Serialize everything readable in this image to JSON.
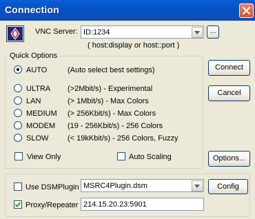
{
  "window": {
    "title": "Connection"
  },
  "server": {
    "label": "VNC Server:",
    "value": "ID:1234",
    "browse_label": "...",
    "hint": "( host:display or host::port )"
  },
  "quick_options": {
    "title": "Quick Options",
    "selected": "AUTO",
    "options": [
      {
        "name": "AUTO",
        "desc": "(Auto select best settings)"
      },
      {
        "name": "ULTRA",
        "desc": "(>2Mbit/s) - Experimental"
      },
      {
        "name": "LAN",
        "desc": "(> 1Mbit/s) - Max Colors"
      },
      {
        "name": "MEDIUM",
        "desc": "(> 256Kbit/s) - Max Colors"
      },
      {
        "name": "MODEM",
        "desc": "(19 - 256Kbit/s) - 256 Colors"
      },
      {
        "name": "SLOW",
        "desc": "(< 19kKbit/s) - 256 Colors, Fuzzy"
      }
    ],
    "view_only": {
      "label": "View Only",
      "checked": false
    },
    "auto_scaling": {
      "label": "Auto Scaling",
      "checked": false
    }
  },
  "buttons": {
    "connect": "Connect",
    "cancel": "Cancel",
    "options": "Options...",
    "config": "Config"
  },
  "dsm": {
    "label": "Use DSMPlugin",
    "checked": false,
    "plugin": "MSRC4Plugin.dsm"
  },
  "proxy": {
    "label": "Proxy/Repeater",
    "checked": true,
    "value": "214.15.20.23:5901"
  }
}
